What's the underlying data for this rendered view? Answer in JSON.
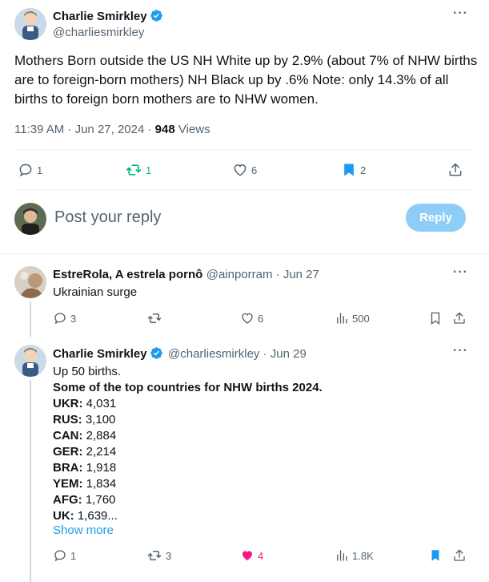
{
  "main_tweet": {
    "author_name": "Charlie Smirkley",
    "handle": "@charliesmirkley",
    "text": "Mothers Born outside the US  NH White up by 2.9% (about 7% of NHW births are to foreign-born mothers) NH Black up by .6%  Note: only 14.3% of all births to foreign born mothers are to NHW women.",
    "time": "11:39 AM · Jun 27, 2024 · ",
    "views_count": "948",
    "views_label": " Views",
    "reply_count": "1",
    "retweet_count": "1",
    "like_count": "6",
    "bookmark_count": "2"
  },
  "composer": {
    "placeholder": "Post your reply",
    "reply_button": "Reply"
  },
  "reply1": {
    "author_name": "EstreRola, A estrela pornô",
    "handle_date": "@ainporram · Jun 27",
    "text": "Ukrainian surge",
    "reply_count": "3",
    "like_count": "6",
    "views": "500"
  },
  "reply2": {
    "author_name": "Charlie Smirkley",
    "handle_date": "@charliesmirkley · Jun 29",
    "line1": "Up 50 births.",
    "heading": "Some of the top countries for NHW births 2024.",
    "countries": [
      {
        "code": "UKR:",
        "value": " 4,031"
      },
      {
        "code": "RUS:",
        "value": " 3,100"
      },
      {
        "code": "CAN:",
        "value": " 2,884"
      },
      {
        "code": "GER:",
        "value": " 2,214"
      },
      {
        "code": "BRA:",
        "value": " 1,918"
      },
      {
        "code": "YEM:",
        "value": " 1,834"
      },
      {
        "code": "AFG:",
        "value": " 1,760"
      },
      {
        "code": "UK:",
        "value": " 1,639..."
      }
    ],
    "show_more": "Show more",
    "reply_count": "1",
    "retweet_count": "3",
    "like_count": "4",
    "views": "1.8K"
  },
  "colors": {
    "accent": "#1d9bf0",
    "retweet_green": "#00ba7c",
    "like_pink": "#f91880",
    "muted": "#536471"
  }
}
